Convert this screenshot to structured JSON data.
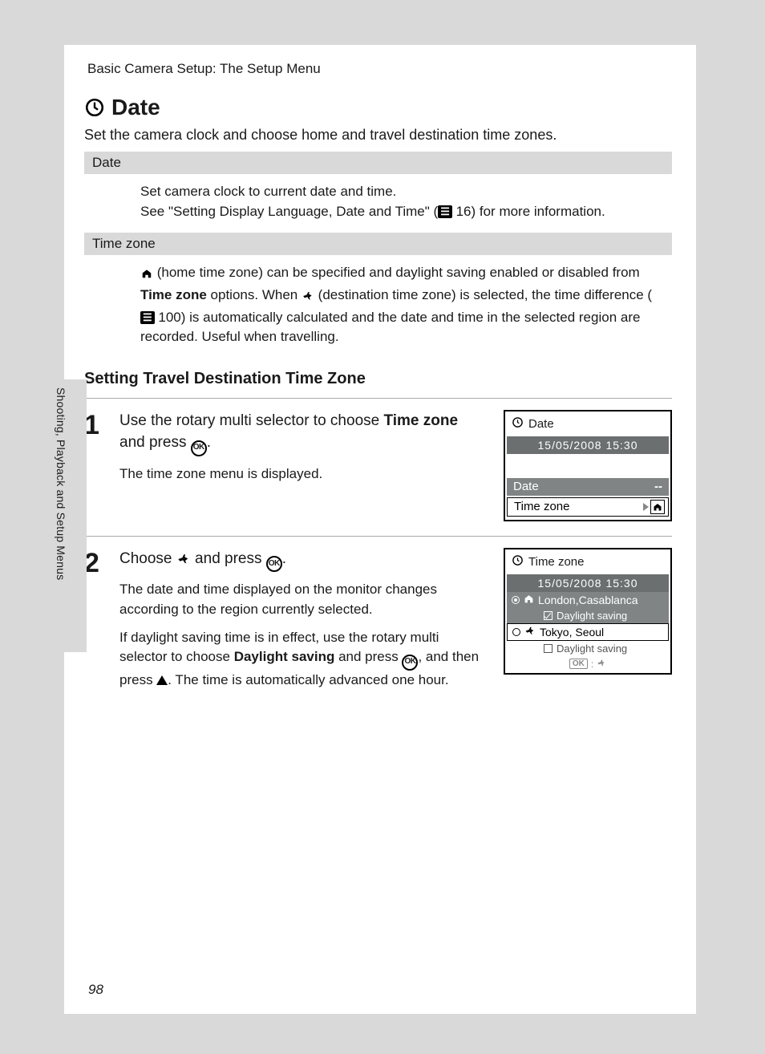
{
  "breadcrumb": "Basic Camera Setup: The Setup Menu",
  "side_tab": "Shooting, Playback and Setup Menus",
  "page_number": "98",
  "h1": "Date",
  "intro": "Set the camera clock and choose home and travel destination time zones.",
  "section_date": {
    "header": "Date",
    "line1": "Set camera clock to current date and time.",
    "line2_a": "See \"Setting Display Language, Date and Time\" (",
    "line2_ref": "16",
    "line2_b": ") for more information."
  },
  "section_tz": {
    "header": "Time zone",
    "para_a": " (home time zone) can be specified and daylight saving enabled or disabled from ",
    "para_bold": "Time zone",
    "para_b": " options. When ",
    "para_c": " (destination time zone) is selected, the time difference (",
    "para_ref": "100",
    "para_d": ") is automatically calculated and the date and time in the selected region are recorded. Useful when travelling."
  },
  "h2": "Setting Travel Destination Time Zone",
  "step1": {
    "num": "1",
    "lead_a": "Use the rotary multi selector to choose ",
    "lead_bold": "Time zone",
    "lead_b": " and press ",
    "lead_c": ".",
    "body": "The time zone menu is displayed.",
    "lcd": {
      "title": "Date",
      "datetime": "15/05/2008   15:30",
      "row_date": "Date",
      "row_date_end": "--",
      "row_tz": "Time zone"
    }
  },
  "step2": {
    "num": "2",
    "lead_a": "Choose ",
    "lead_b": " and press ",
    "lead_c": ".",
    "p1": "The date and time displayed on the monitor changes according to the region currently selected.",
    "p2_a": "If daylight saving time is in effect, use the rotary multi selector to choose ",
    "p2_bold": "Daylight saving",
    "p2_b": " and press ",
    "p2_c": ", and then press ",
    "p2_d": ". The time is automatically advanced one hour.",
    "lcd": {
      "title": "Time zone",
      "datetime": "15/05/2008    15:30",
      "home": "London,Casablanca",
      "home_ds": "Daylight saving",
      "dest": "Tokyo, Seoul",
      "dest_ds": "Daylight saving",
      "ok_hint": "OK"
    }
  },
  "ok_label": "OK"
}
